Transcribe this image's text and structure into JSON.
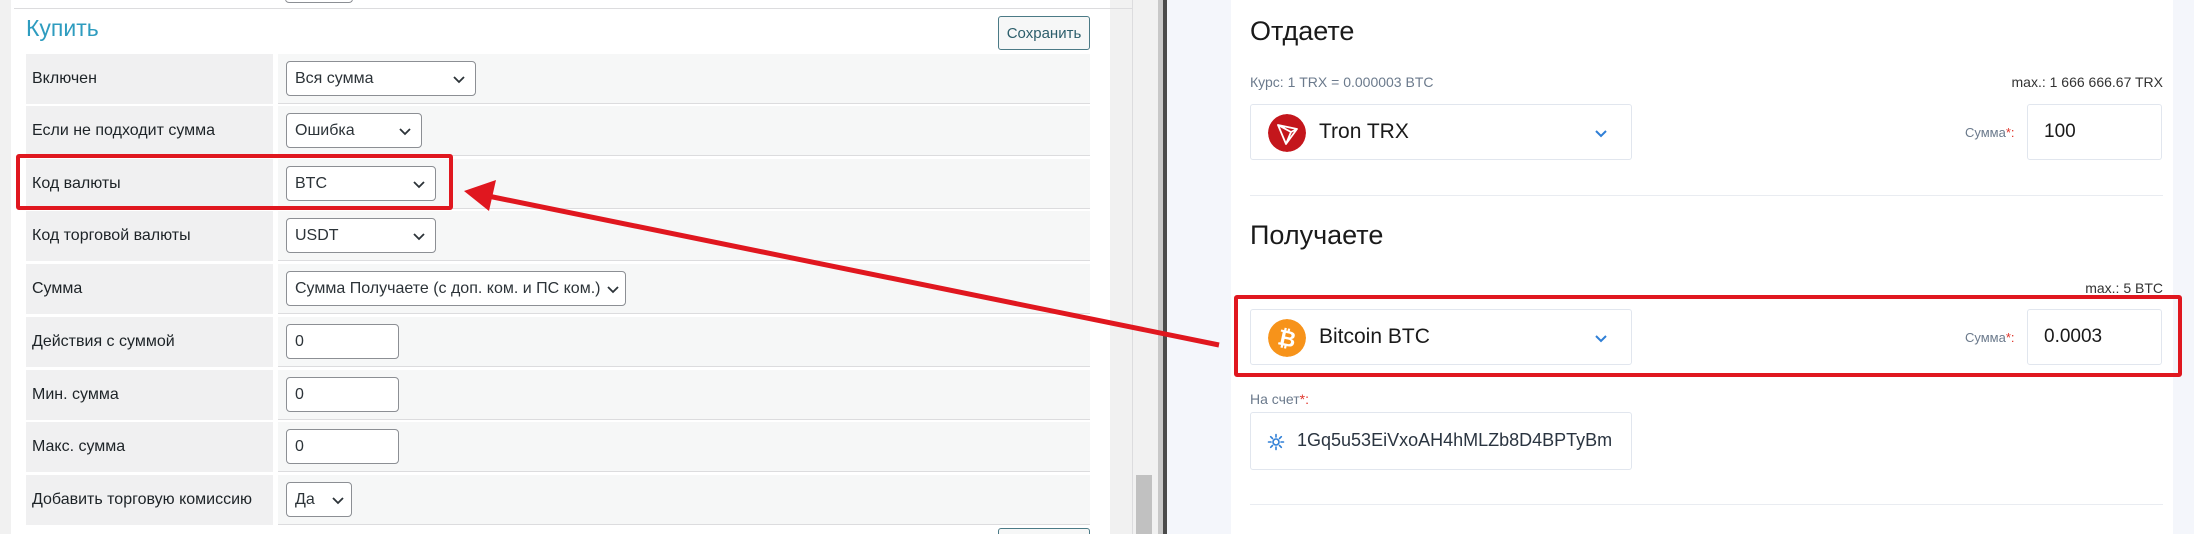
{
  "admin": {
    "section_title": "Купить",
    "save_label": "Сохранить",
    "rows": [
      {
        "label": "Включен",
        "type": "select",
        "value": "Вся сумма"
      },
      {
        "label": "Если не подходит сумма",
        "type": "select",
        "value": "Ошибка"
      },
      {
        "label": "Код валюты",
        "type": "select",
        "value": "BTC"
      },
      {
        "label": "Код торговой валюты",
        "type": "select",
        "value": "USDT"
      },
      {
        "label": "Сумма",
        "type": "select",
        "value": "Сумма Получаете (с доп. ком. и ПС ком.)"
      },
      {
        "label": "Действия с суммой",
        "type": "text",
        "value": "0"
      },
      {
        "label": "Мин. сумма",
        "type": "text",
        "value": "0"
      },
      {
        "label": "Макс. сумма",
        "type": "text",
        "value": "0"
      },
      {
        "label": "Добавить торговую комиссию",
        "type": "select",
        "value": "Да"
      }
    ]
  },
  "exchange": {
    "give": {
      "title": "Отдаете",
      "rate": "Курс: 1 TRX = 0.000003 BTC",
      "max": "max.: 1 666 666.67 TRX",
      "currency": "Tron TRX",
      "amount_label": "Сумма",
      "amount": "100"
    },
    "get": {
      "title": "Получаете",
      "max": "max.: 5 BTC",
      "currency": "Bitcoin BTC",
      "amount_label": "Сумма",
      "amount": "0.0003"
    },
    "account": {
      "label": "На счет",
      "value": "1Gq5u53EiVxoAH4hMLZb8D4BPTyBm"
    },
    "required_mark": "*:"
  },
  "colors": {
    "accent_title": "#2e9cbf",
    "annotation_red": "#e0171f",
    "tron_red": "#c4161c",
    "bitcoin_orange": "#f7931a",
    "chevron_blue": "#2f7fd6"
  },
  "icons": {
    "tron_logo": "tron-logo-icon",
    "bitcoin_logo": "bitcoin-logo-icon",
    "chevron": "chevron-down-icon",
    "account_settings": "gear-icon"
  }
}
